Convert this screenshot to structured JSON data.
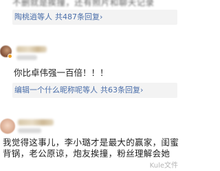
{
  "thread": {
    "prev_comment_text_tail": "不删就是挨撞，还有照片和聊天记录",
    "reply_box_1": {
      "participants": "陶桃逍等人",
      "total_label": "共487条回复",
      "chevron": "›"
    },
    "comment_2": {
      "text": "你比卓伟强一百倍！！！",
      "reply_box": {
        "participants": "编辑一个什么昵称呢等人",
        "total_label": "共63条回复",
        "chevron": "›"
      }
    },
    "comment_3": {
      "text": "我觉得这事儿，李小璐才是最大的赢家，闺蜜背锅，老公原谅，炮友挨撞，粉丝理解会她"
    }
  },
  "watermark": "Kule文件",
  "colors": {
    "link": "#4a6eaa",
    "reply_bg": "#f3f3f3",
    "text": "#222222"
  }
}
